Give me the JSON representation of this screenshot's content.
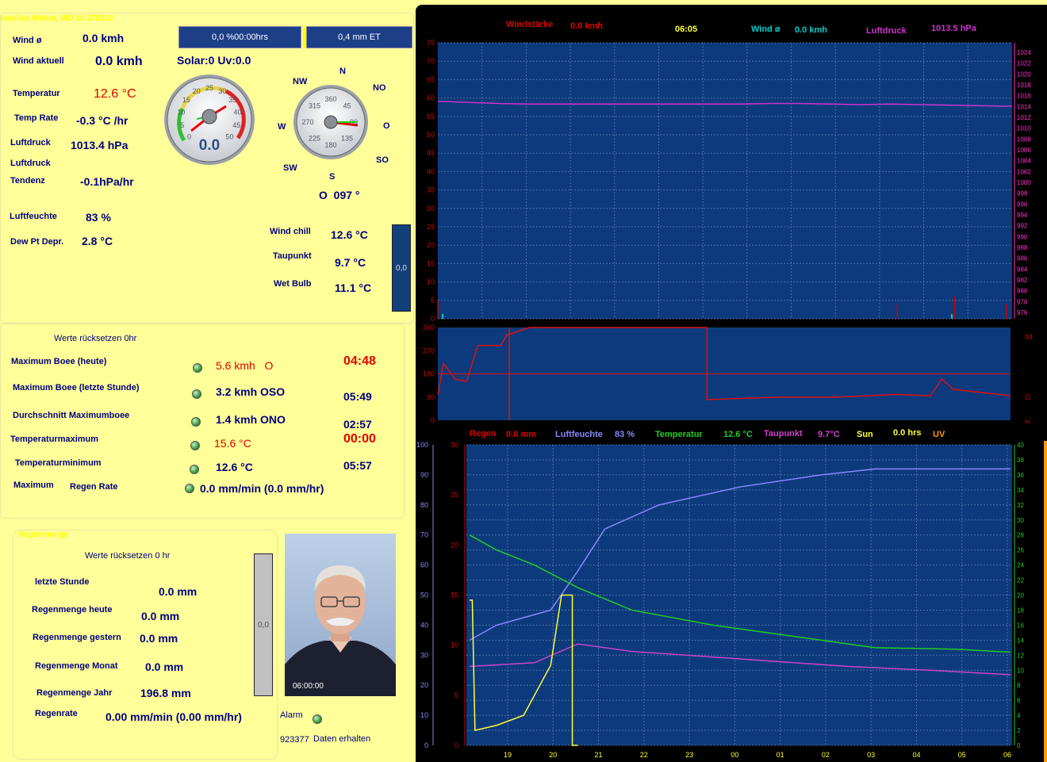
{
  "header": {
    "title": "ktuelles Wetter, WD 10.375132"
  },
  "top_buttons": {
    "sun": "0,0 %00:00hrs",
    "et": "0,4 mm ET"
  },
  "solar": "Solar:0 Uv:0.0",
  "current": {
    "wind_avg_label": "Wind ø",
    "wind_avg": "0.0 kmh",
    "wind_now_label": "Wind aktuell",
    "wind_now": "0.0 kmh",
    "temp_label": "Temperatur",
    "temp": "12.6 °C",
    "temp_rate_label": "Temp Rate",
    "temp_rate": "-0.3 °C /hr",
    "pressure_label": "Luftdruck",
    "pressure": "1013.4 hPa",
    "trend_label1": "Luftdruck",
    "trend_label2": "Tendenz",
    "trend": "-0.1hPa/hr",
    "humidity_label": "Luftfeuchte",
    "humidity": "83 %",
    "dewdep_label": "Dew Pt Depr.",
    "dewdep": "2.8 °C"
  },
  "gauge_speed": {
    "ticks": [
      "0",
      "5",
      "10",
      "15",
      "20",
      "25",
      "30",
      "35",
      "40",
      "45",
      "50"
    ],
    "value": "0.0"
  },
  "compass": {
    "n": "N",
    "no": "NO",
    "o": "O",
    "so": "SO",
    "s": "S",
    "sw": "SW",
    "w": "W",
    "nw": "NW",
    "ticks": [
      "360",
      "45",
      "90",
      "135",
      "180",
      "225",
      "270",
      "315"
    ],
    "reading": "O  097 °"
  },
  "extra": {
    "windchill_label": "Wind chill",
    "windchill": "12.6 °C",
    "dewpoint_label": "Taupunkt",
    "dewpoint": "9.7 °C",
    "wetbulb_label": "Wet Bulb",
    "wetbulb": "11.1 °C",
    "bar_value": "0,0"
  },
  "records": {
    "reset": "Werte rücksetzen 0hr",
    "rows": [
      {
        "label": "Maximum Boee (heute)",
        "value": "5.6 kmh   O",
        "time": "04:48"
      },
      {
        "label": "Maximum Boee (letzte Stunde)",
        "value": "3.2 kmh OSO",
        "time": "05:49"
      },
      {
        "label": "Durchschnitt Maximumboee",
        "value": "1.4 kmh ONO",
        "time": "02:57"
      },
      {
        "label": "Temperaturmaximum",
        "value": "15.6 °C",
        "time": "00:00"
      },
      {
        "label": "Temperaturminimum",
        "value": "12.6 °C",
        "time": "05:57"
      }
    ],
    "rain_rate_label1": "Maximum",
    "rain_rate_label2": "Regen Rate",
    "rain_rate": "0.0 mm/min (0.0 mm/hr)"
  },
  "rain": {
    "title": "Regenmenge",
    "reset": "Werte rücksetzen 0 hr",
    "last_hour_label": "letzte Stunde",
    "last_hour": "0.0 mm",
    "today_label": "Regenmenge heute",
    "today": "0.0 mm",
    "yesterday_label": "Regenmenge gestern",
    "yesterday": "0.0 mm",
    "month_label": "Regenmenge Monat",
    "month": "0.0 mm",
    "year_label": "Regenmenge Jahr",
    "year": "196.8 mm",
    "rate_label": "Regenrate",
    "rate": "0.00 mm/min (0.00 mm/hr)",
    "bar_value": "0,0"
  },
  "webcam": {
    "time": "06:00:00"
  },
  "status": {
    "alarm": "Alarm",
    "count": "923377",
    "data": "Daten erhalten"
  },
  "chart_data": [
    {
      "type": "line",
      "legend": {
        "wind_label": "Windstärke",
        "wind": "0.0 kmh",
        "time": "06:05",
        "avg_label": "Wind ø",
        "avg": "0.0 kmh",
        "press_label": "Luftdruck",
        "press": "1013.5 hPa"
      },
      "ylim_left": [
        0,
        75
      ],
      "yticks_left": [
        "75",
        "70",
        "65",
        "60",
        "55",
        "50",
        "45",
        "40",
        "35",
        "30",
        "25",
        "20",
        "15",
        "10",
        "5",
        "0"
      ],
      "ylim_right": [
        975,
        1025
      ],
      "yticks_right": [
        "1024",
        "1022",
        "1020",
        "1018",
        "1016",
        "1014",
        "1012",
        "1010",
        "1008",
        "1006",
        "1004",
        "1002",
        "1000",
        "998",
        "996",
        "994",
        "992",
        "990",
        "988",
        "986",
        "984",
        "982",
        "980",
        "978",
        "976"
      ],
      "pressure": [
        1014.4,
        1014.2,
        1014.0,
        1013.9,
        1013.9,
        1013.9,
        1013.9,
        1013.9,
        1013.9,
        1013.9,
        1013.9,
        1014.0,
        1014.0,
        1013.9,
        1013.8,
        1013.9,
        1013.8,
        1013.7,
        1013.6,
        1013.5
      ],
      "wind": [
        [
          0,
          5
        ],
        [
          0.005,
          0
        ],
        [
          0.8,
          4
        ],
        [
          0.805,
          0
        ],
        [
          0.9,
          6
        ],
        [
          0.905,
          0
        ],
        [
          0.99,
          4
        ],
        [
          0.995,
          0
        ]
      ],
      "colors": {
        "pressure": "#cc33cc",
        "wind": "#cc0000",
        "avg": "#00cccc"
      }
    },
    {
      "type": "line",
      "yticks": [
        "360",
        "270",
        "180",
        "90",
        "0"
      ],
      "ylim": [
        0,
        360
      ],
      "right_labels": {
        "top": "94",
        "mid": "O",
        "bottom": "N"
      },
      "direction": [
        [
          0,
          100
        ],
        [
          0.01,
          220
        ],
        [
          0.03,
          160
        ],
        [
          0.05,
          150
        ],
        [
          0.07,
          290
        ],
        [
          0.11,
          290
        ],
        [
          0.12,
          330
        ],
        [
          0.16,
          360
        ],
        [
          0.47,
          360
        ],
        [
          0.47,
          80
        ],
        [
          0.6,
          90
        ],
        [
          0.7,
          90
        ],
        [
          0.8,
          100
        ],
        [
          0.86,
          95
        ],
        [
          0.88,
          160
        ],
        [
          0.9,
          120
        ],
        [
          1,
          95
        ]
      ],
      "line180": 180,
      "color": "#dd1111"
    },
    {
      "type": "line",
      "legend": {
        "rain_label": "Regen",
        "rain": "0.0 mm",
        "hum_label": "Luftfeuchte",
        "hum": "83 %",
        "temp_label": "Temperatur",
        "temp": "12.6 °C",
        "dew_label": "Taupunkt",
        "dew": "9.7°C",
        "sun_label": "Sun",
        "sun": "0.0 hrs",
        "uv_label": "UV"
      },
      "yticks_outer": [
        "100",
        "90",
        "80",
        "70",
        "60",
        "50",
        "40",
        "30",
        "20",
        "10",
        "0"
      ],
      "yticks_rain": [
        "30",
        "25",
        "20",
        "15",
        "10",
        "5",
        "0"
      ],
      "yticks_right": [
        "40",
        "38",
        "36",
        "34",
        "32",
        "30",
        "28",
        "26",
        "24",
        "22",
        "20",
        "18",
        "16",
        "14",
        "12",
        "10",
        "8",
        "6",
        "4",
        "2",
        "0"
      ],
      "xticks": [
        "19",
        "20",
        "21",
        "22",
        "23",
        "00",
        "01",
        "02",
        "03",
        "04",
        "05",
        "06"
      ],
      "humidity": [
        [
          0,
          35
        ],
        [
          0.05,
          40
        ],
        [
          0.15,
          45
        ],
        [
          0.2,
          58
        ],
        [
          0.25,
          72
        ],
        [
          0.35,
          80
        ],
        [
          0.5,
          86
        ],
        [
          0.65,
          90
        ],
        [
          0.75,
          92
        ],
        [
          0.9,
          92
        ],
        [
          1,
          92
        ]
      ],
      "temperature": [
        [
          0,
          28
        ],
        [
          0.05,
          26
        ],
        [
          0.12,
          24
        ],
        [
          0.2,
          21
        ],
        [
          0.3,
          18
        ],
        [
          0.45,
          16
        ],
        [
          0.6,
          14.5
        ],
        [
          0.75,
          13
        ],
        [
          0.9,
          12.8
        ],
        [
          1,
          12.4
        ]
      ],
      "dewpoint": [
        [
          0,
          10.5
        ],
        [
          0.12,
          11
        ],
        [
          0.2,
          13.5
        ],
        [
          0.3,
          12.5
        ],
        [
          0.5,
          11.5
        ],
        [
          0.7,
          10.5
        ],
        [
          0.85,
          10
        ],
        [
          1,
          9.4
        ]
      ],
      "solar": [
        [
          0,
          14.5
        ],
        [
          0.005,
          14.5
        ],
        [
          0.01,
          1.5
        ],
        [
          0.05,
          2
        ],
        [
          0.1,
          3
        ],
        [
          0.15,
          8
        ],
        [
          0.17,
          15
        ],
        [
          0.19,
          15
        ],
        [
          0.19,
          0
        ],
        [
          0.2,
          0
        ]
      ],
      "colors": {
        "humidity": "#8888ff",
        "temperature": "#22cc22",
        "dewpoint": "#cc44cc",
        "solar": "#ffff33"
      }
    }
  ]
}
